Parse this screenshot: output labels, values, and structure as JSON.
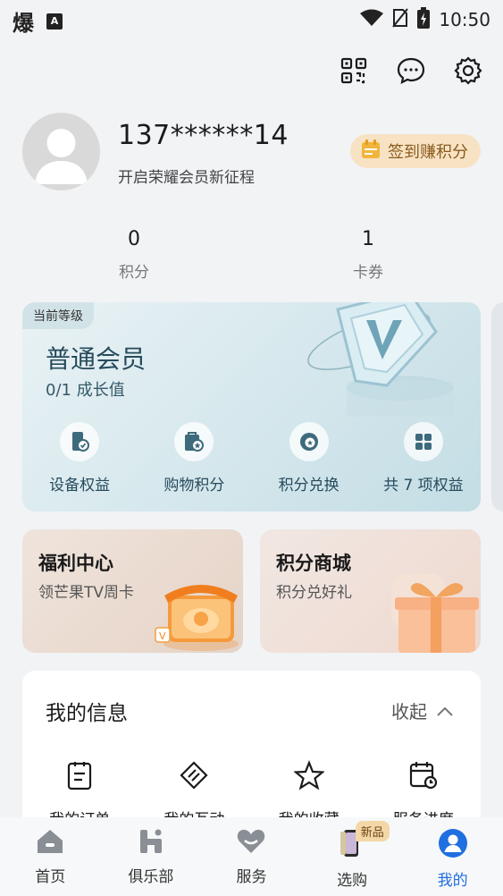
{
  "status_bar": {
    "left_glyph": "爆",
    "left_badge": "A",
    "time": "10:50"
  },
  "profile": {
    "phone": "137******14",
    "subtitle": "开启荣耀会员新征程",
    "checkin_label": "签到赚积分"
  },
  "stats": [
    {
      "value": "0",
      "label": "积分"
    },
    {
      "value": "1",
      "label": "卡券"
    }
  ],
  "membership": {
    "tag": "当前等级",
    "level": "普通会员",
    "growth": "0/1 成长值",
    "benefits": [
      {
        "label": "设备权益",
        "icon": "device-icon"
      },
      {
        "label": "购物积分",
        "icon": "shopping-icon"
      },
      {
        "label": "积分兑换",
        "icon": "exchange-icon"
      },
      {
        "label": "共 7 项权益",
        "icon": "grid-icon"
      }
    ]
  },
  "promos": [
    {
      "title": "福利中心",
      "subtitle": "领芒果TV周卡"
    },
    {
      "title": "积分商城",
      "subtitle": "积分兑好礼"
    }
  ],
  "my_info": {
    "title": "我的信息",
    "collapse_label": "收起",
    "items": [
      {
        "label": "我的订单",
        "icon": "order-icon"
      },
      {
        "label": "我的互动",
        "icon": "interaction-icon"
      },
      {
        "label": "我的收藏",
        "icon": "star-icon"
      },
      {
        "label": "服务进度",
        "icon": "calendar-icon"
      }
    ]
  },
  "bottom_nav": [
    {
      "label": "首页",
      "icon": "home-icon"
    },
    {
      "label": "俱乐部",
      "icon": "club-icon"
    },
    {
      "label": "服务",
      "icon": "heart-icon"
    },
    {
      "label": "选购",
      "icon": "phone-icon",
      "badge": "新品"
    },
    {
      "label": "我的",
      "icon": "user-icon",
      "active": true
    }
  ],
  "colors": {
    "accent": "#1f6fe0",
    "checkin_bg": "#f7e3c4",
    "member_text": "#264a5c"
  }
}
